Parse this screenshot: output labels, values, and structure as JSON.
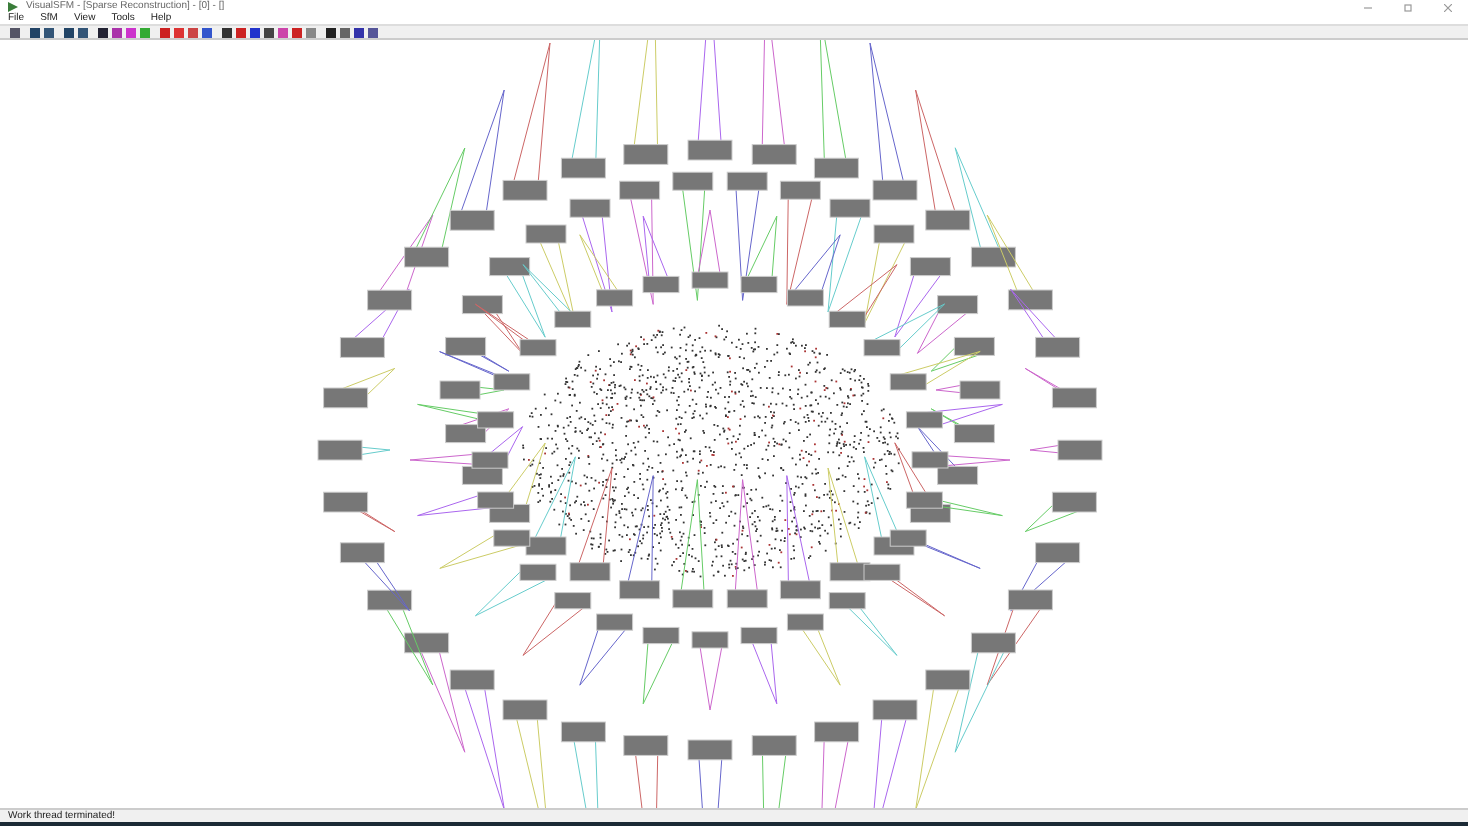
{
  "window": {
    "title": "VisualSFM - [Sparse Reconstruction] - [0] - []"
  },
  "menu": [
    "File",
    "SfM",
    "View",
    "Tools",
    "Help"
  ],
  "status_bar": {
    "text": "Work thread terminated!"
  }
}
